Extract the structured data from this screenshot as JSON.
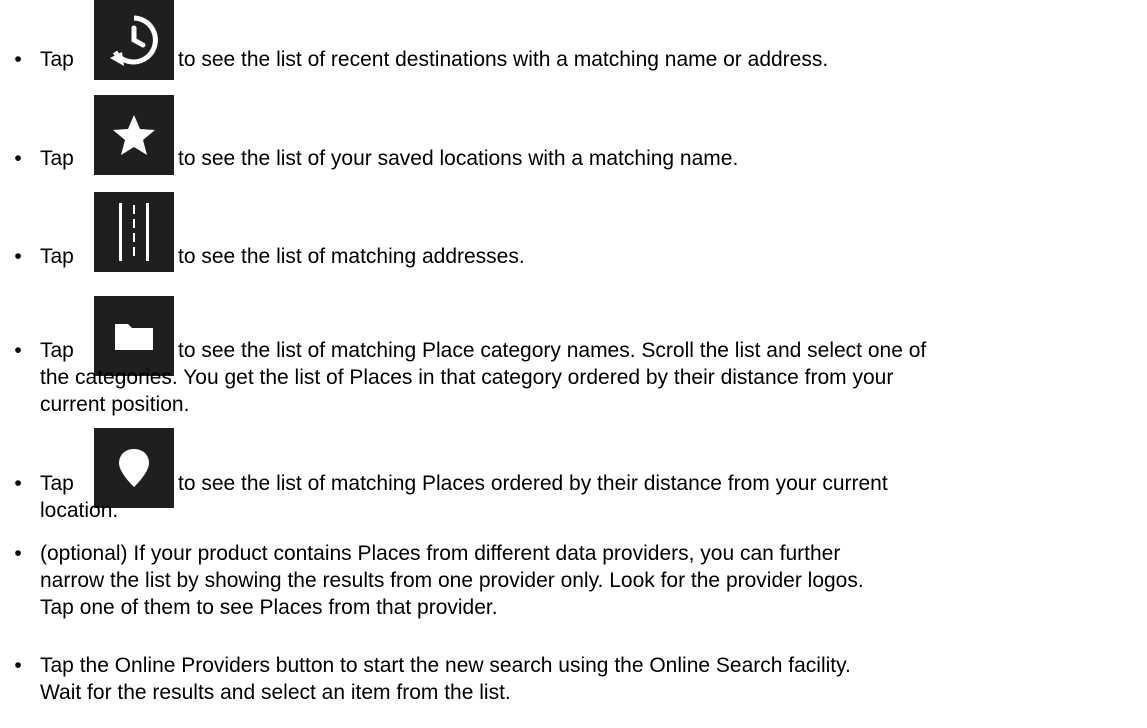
{
  "items": [
    {
      "tap": "Tap",
      "text": "to see the list of recent destinations with a matching name or address.",
      "icon": "recent-history-icon"
    },
    {
      "tap": "Tap",
      "text": "to see the list of your saved locations with a matching name.",
      "icon": "star-icon"
    },
    {
      "tap": "Tap",
      "text": "to see the list of matching addresses.",
      "icon": "road-icon"
    },
    {
      "tap": "Tap",
      "text": "to see the list of matching Place category names. Scroll the list and select one of",
      "icon": "folder-icon",
      "cont1": "the categories. You get the list of Places in that category ordered by their distance from your",
      "cont2": "current position."
    },
    {
      "tap": "Tap",
      "text": "to see the list of matching Places ordered by their distance from your current",
      "icon": "location-pin-icon",
      "cont1": "location."
    },
    {
      "line1": "(optional) If your product contains Places from different data providers, you can further",
      "line2": "narrow the list by showing the results from one provider only. Look for the provider logos.",
      "line3": "Tap one of them to see Places from that provider."
    },
    {
      "line1": "Tap the Online Providers button to start the new search using the Online Search facility.",
      "line2": "Wait for the results and select an item from the list."
    }
  ],
  "colors": {
    "icon_bg": "#1f1f1f",
    "icon_fg": "#ffffff",
    "text": "#000000"
  }
}
